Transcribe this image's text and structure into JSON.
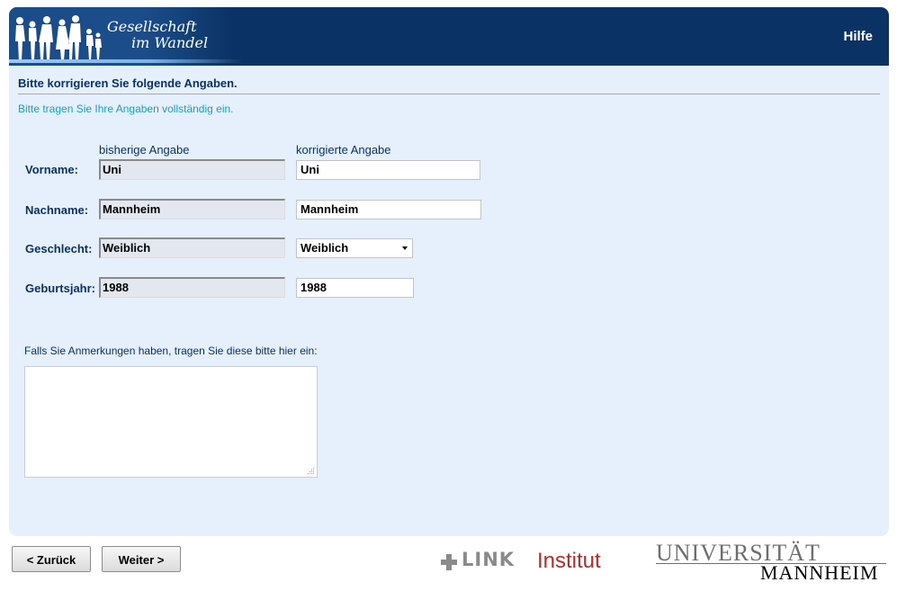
{
  "header": {
    "logo_line1": "Gesellschaft",
    "logo_line2": "im Wandel",
    "help_label": "Hilfe"
  },
  "form": {
    "title": "Bitte korrigieren Sie folgende Angaben.",
    "instruction": "Bitte tragen Sie Ihre Angaben vollständig ein.",
    "col_old": "bisherige Angabe",
    "col_new": "korrigierte Angabe",
    "rows": [
      {
        "label": "Vorname:",
        "old": "Uni",
        "new": "Uni"
      },
      {
        "label": "Nachname:",
        "old": "Mannheim",
        "new": "Mannheim"
      },
      {
        "label": "Geschlecht:",
        "old": "Weiblich",
        "new": "Weiblich"
      },
      {
        "label": "Geburtsjahr:",
        "old": "1988",
        "new": "1988"
      }
    ],
    "notes_label": "Falls Sie Anmerkungen haben, tragen Sie diese bitte hier ein:",
    "notes_value": ""
  },
  "nav": {
    "back_label": "< Zurück",
    "next_label": "Weiter >"
  },
  "footer": {
    "link_word": "LINK",
    "link_institut": "Institut",
    "uni_line1": "UNIVERSITÄT",
    "uni_line2": "MANNHEIM"
  },
  "colors": {
    "header_bg": "#0b3264",
    "panel_bg": "#e6f0fc",
    "label_color": "#0b3264",
    "instruction_color": "#1a9dc4",
    "link_red": "#b82929"
  }
}
